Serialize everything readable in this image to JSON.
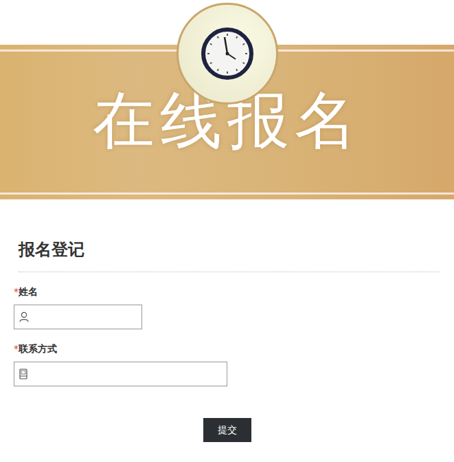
{
  "banner": {
    "title": "在线报名"
  },
  "form": {
    "title": "报名登记",
    "fields": [
      {
        "label": "姓名",
        "required": true,
        "kind": "name"
      },
      {
        "label": "联系方式",
        "required": true,
        "kind": "phone"
      }
    ],
    "submit": "提交"
  }
}
